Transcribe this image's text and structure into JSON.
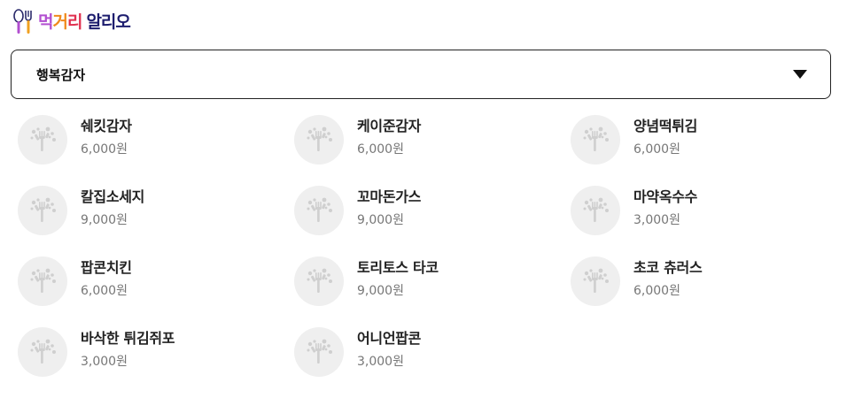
{
  "brand": {
    "part1": "먹",
    "part2": "거",
    "part3": "리",
    "part4": "알리오"
  },
  "store_select": {
    "selected": "행복감자"
  },
  "menu_items": [
    {
      "name": "쉐킷감자",
      "price": "6,000원"
    },
    {
      "name": "케이준감자",
      "price": "6,000원"
    },
    {
      "name": "양념떡튀김",
      "price": "6,000원"
    },
    {
      "name": "칼집소세지",
      "price": "9,000원"
    },
    {
      "name": "꼬마돈가스",
      "price": "9,000원"
    },
    {
      "name": "마약옥수수",
      "price": "3,000원"
    },
    {
      "name": "팝콘치킨",
      "price": "6,000원"
    },
    {
      "name": "토리토스 타코",
      "price": "9,000원"
    },
    {
      "name": "초코 츄러스",
      "price": "6,000원"
    },
    {
      "name": "바삭한 튀김쥐포",
      "price": "3,000원"
    },
    {
      "name": "어니언팝콘",
      "price": "3,000원"
    }
  ]
}
